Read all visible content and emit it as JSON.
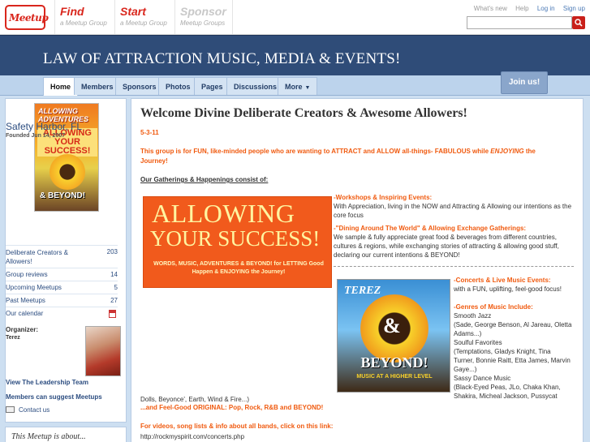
{
  "topbar": {
    "logo_text": "Meetup",
    "nav": [
      {
        "title": "Find",
        "subtitle": "a Meetup Group"
      },
      {
        "title": "Start",
        "subtitle": "a Meetup Group"
      },
      {
        "title": "Sponsor",
        "subtitle": "Meetup Groups"
      }
    ],
    "links": {
      "whats_new": "What's new",
      "help": "Help",
      "login": "Log in",
      "signup": "Sign up"
    },
    "search_placeholder": ""
  },
  "banner": {
    "title": "LAW OF ATTRACTION MUSIC, MEDIA & EVENTS!"
  },
  "tabs": [
    {
      "label": "Home"
    },
    {
      "label": "Members"
    },
    {
      "label": "Sponsors"
    },
    {
      "label": "Photos"
    },
    {
      "label": "Pages"
    },
    {
      "label": "Discussions"
    },
    {
      "label": "More"
    }
  ],
  "join_label": "Join us!",
  "sidebar": {
    "photo_text": {
      "top": "ALLOWING ADVENTURES",
      "middle": "ALLOWING YOUR SUCCESS!",
      "bottom": "& BEYOND!"
    },
    "city": "Safety Harbor, FL",
    "founded": "Founded Jun 14, 2007",
    "stats": [
      {
        "label": "Deliberate Creators & Allowers!",
        "value": "203"
      },
      {
        "label": "Group reviews",
        "value": "14"
      },
      {
        "label": "Upcoming Meetups",
        "value": "5"
      },
      {
        "label": "Past Meetups",
        "value": "27"
      },
      {
        "label": "Our calendar",
        "value": ""
      }
    ],
    "organizer_label": "Organizer:",
    "organizer_name": "Terez",
    "leadership_link": "View The Leadership Team",
    "suggest_text": "Members can suggest Meetups",
    "contact_label": "Contact us",
    "about_title": "This Meetup is about..."
  },
  "main": {
    "heading": "Welcome Divine Deliberate Creators & Awesome Allowers!",
    "date": "5-3-11",
    "intro_1": "This group is for FUN, like-minded people who are wanting to ATTRACT and ALLOW all-things- FABULOUS while",
    "intro_enjoying": "ENJOYING",
    "intro_2": "the",
    "intro_3": "Journey!",
    "gatherings_heading": "Our Gatherings & Happenings consist of:",
    "allowing_img": {
      "line1": "ALLOWING",
      "line2": "YOUR SUCCESS!",
      "line3": "WORDS, MUSIC, ADVENTURES & BEYOND! for LETTING Good Happen & ENJOYING the Journey!"
    },
    "workshops_title": "-Workshops & Inspiring Events:",
    "workshops_text": "With Appreciation, living in the NOW and Attracting & Allowing our intentions as the core focus",
    "dining_title": "-\"Dining Around The World\" & Allowing Exchange Gatherings:",
    "dining_text": "We sample & fully appreciate great food & beverages from different countries, cultures & regions, while exchanging stories of attracting & allowing good stuff, declaring our current intentions & BEYOND!",
    "beyond_img": {
      "name": "TEREZ",
      "amp": "&",
      "line1": "BEYOND!",
      "line2": "MUSIC AT A HIGHER LEVEL"
    },
    "concerts_title": "-Concerts & Live Music Events:",
    "concerts_text": "with a FUN, uplifting, feel-good focus!",
    "genres_title": "-Genres of Music Include:",
    "genres_lines": [
      "Smooth Jazz",
      "(Sade, George Benson, Al Jareau, Oletta",
      "Adams...)",
      "Soulful Favorites",
      "(Temptations, Gladys Knight, Tina",
      "Turner, Bonnie Raitt, Etta James, Marvin",
      "Gaye...)",
      "Sassy Dance Music",
      "(Black-Eyed Peas, JLo, Chaka Khan,",
      "Shakira, Micheal Jackson, Pussycat"
    ],
    "genres_tail": "Dolls, Beyonce', Earth, Wind & Fire...)",
    "feelgood": "...and Feel-Good ORIGINAL: Pop, Rock, R&B and BEYOND!",
    "videos_line": "For videos, song lists & info about all bands, click on this link:",
    "videos_url": "http://rockmyspirit.com/concerts.php"
  }
}
